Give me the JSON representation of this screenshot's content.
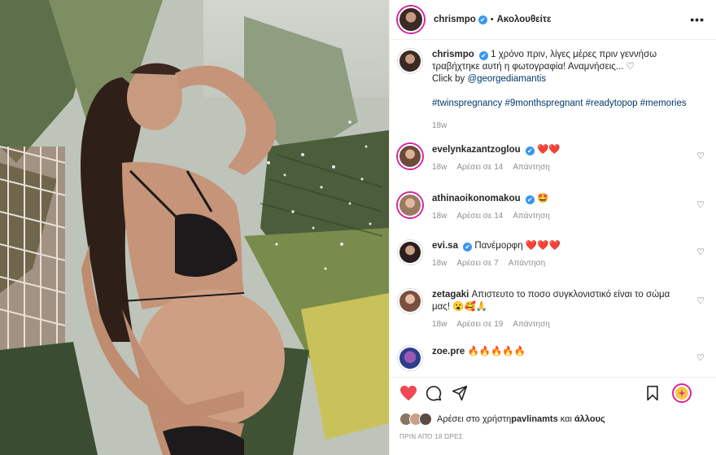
{
  "header": {
    "username": "chrismpo",
    "verified_mark": "✔",
    "separator": "•",
    "follow_status": "Ακολουθείτε",
    "more_icon": "more-horizontal-icon"
  },
  "caption": {
    "username": "chrismpo",
    "verified_mark": "✔",
    "text": "1 χρόνο πριν, λίγες μέρες πριν γεννήσω τραβήχτηκε αυτή η φωτογραφία! Αναμνήσεις... ♡",
    "credit_prefix": "Click by ",
    "credit_mention": "@georgediamantis",
    "hashtags": "#twinspregnancy #9monthspregnant #readytopop #memories",
    "age": "18w"
  },
  "comments": [
    {
      "username": "evelynkazantzoglou",
      "verified": true,
      "text": "❤️❤️",
      "age": "18w",
      "likes": "Αρέσει σε 14",
      "reply": "Απάντηση"
    },
    {
      "username": "athinaoikonomakou",
      "verified": true,
      "text": "🤩",
      "age": "18w",
      "likes": "Αρέσει σε 14",
      "reply": "Απάντηση"
    },
    {
      "username": "evi.sa",
      "verified": true,
      "text": "Πανέμορφη ❤️❤️❤️",
      "age": "18w",
      "likes": "Αρέσει σε 7",
      "reply": "Απάντηση"
    },
    {
      "username": "zetagaki",
      "verified": false,
      "text": "Απιστευτο το ποσο συγκλονιστικό είναι το σώμα μας! 😮🥰🙏",
      "age": "18w",
      "likes": "Αρέσει σε 19",
      "reply": "Απάντηση"
    },
    {
      "username": "zoe.pre",
      "verified": false,
      "text": "🔥🔥🔥🔥🔥",
      "age": "",
      "likes": "",
      "reply": ""
    }
  ],
  "actions": {
    "like_icon": "heart-filled-icon",
    "comment_icon": "comment-icon",
    "share_icon": "paper-plane-icon",
    "save_icon": "bookmark-icon",
    "like_color": "#ed4956"
  },
  "likes_line": {
    "prefix": "Αρέσει στο χρήστη ",
    "user": "pavlinamts",
    "suffix": " και ",
    "others": "άλλους"
  },
  "timestamp": "ΠΡΙΝ ΑΠΌ 18 ΏΡΕΣ"
}
